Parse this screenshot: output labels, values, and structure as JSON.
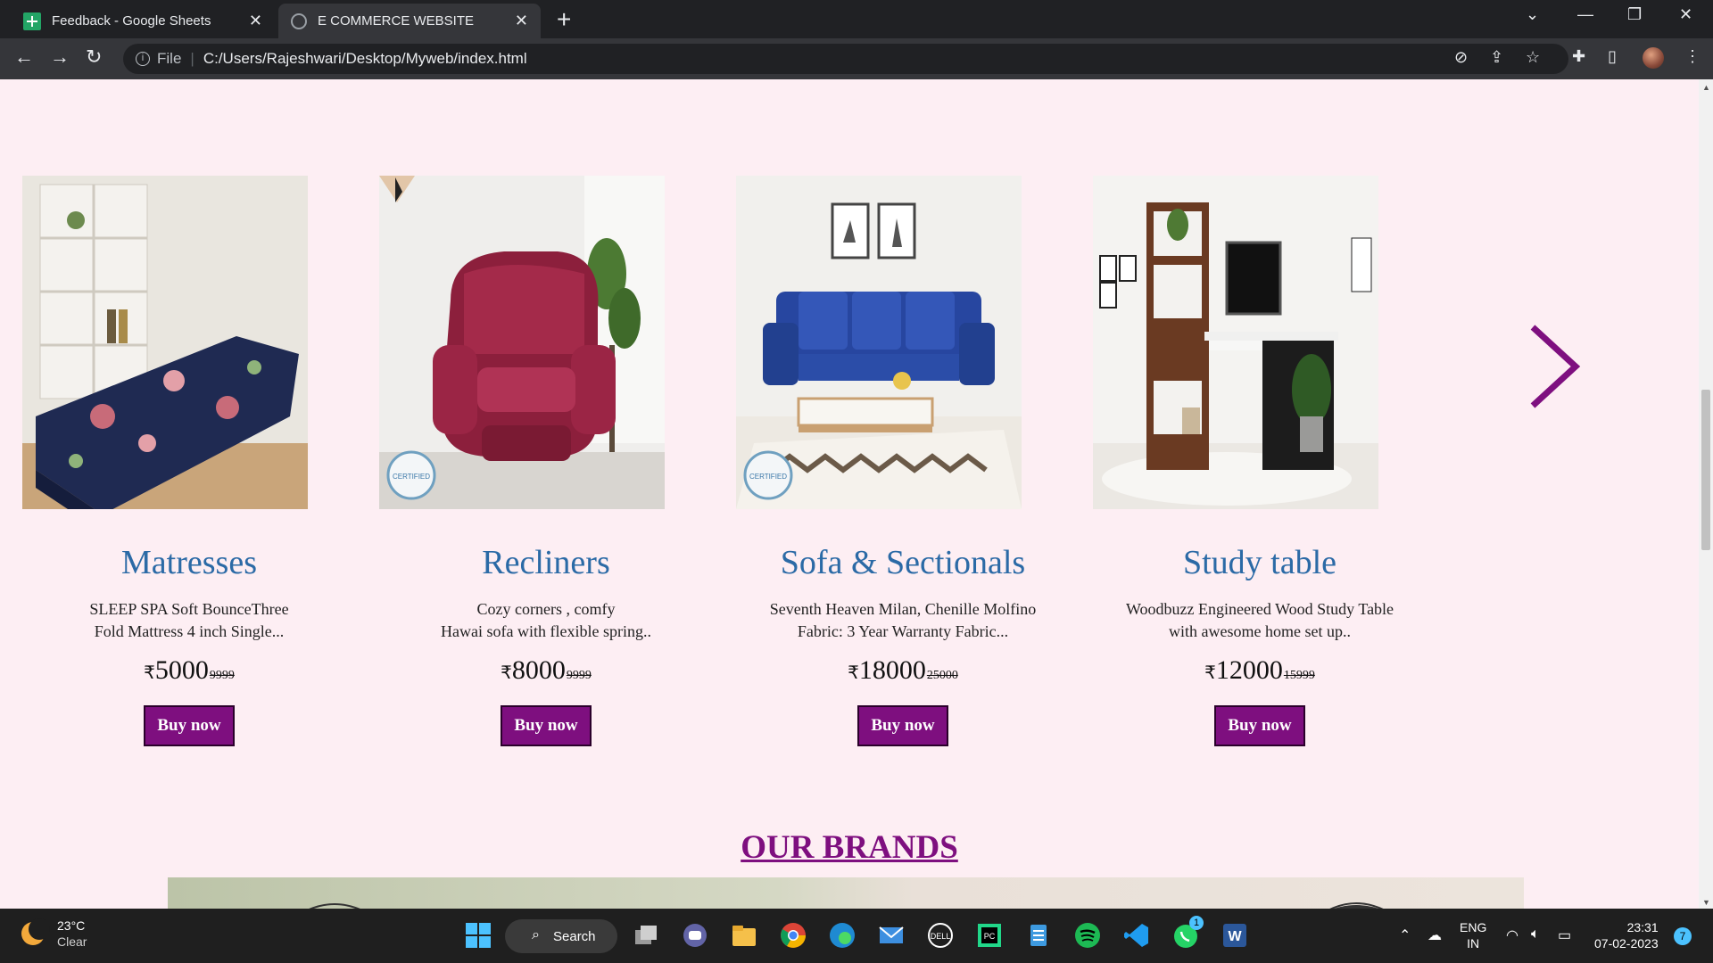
{
  "browser": {
    "tabs": [
      {
        "title": "Feedback - Google Sheets",
        "icon": "sheets-icon"
      },
      {
        "title": "E COMMERCE WEBSITE",
        "icon": "globe-icon",
        "active": true
      }
    ],
    "address": {
      "scheme_label": "File",
      "url": "C:/Users/Rajeshwari/Desktop/Myweb/index.html"
    }
  },
  "products": [
    {
      "name": "Matresses",
      "desc_line1": "SLEEP SPA Soft BounceThree",
      "desc_line2": "Fold Mattress 4 inch Single...",
      "currency": "₹",
      "price": "5000",
      "old_price": "9999",
      "buy_label": "Buy now"
    },
    {
      "name": "Recliners",
      "desc_line1": "Cozy corners , comfy",
      "desc_line2": "Hawai sofa with flexible spring..",
      "currency": "₹",
      "price": "8000",
      "old_price": "9999",
      "buy_label": "Buy now"
    },
    {
      "name": "Sofa & Sectionals",
      "desc_line1": "Seventh Heaven Milan, Chenille Molfino",
      "desc_line2": "Fabric: 3 Year Warranty Fabric...",
      "currency": "₹",
      "price": "18000",
      "old_price": "25000",
      "buy_label": "Buy now"
    },
    {
      "name": "Study table",
      "desc_line1": "Woodbuzz Engineered Wood Study Table",
      "desc_line2": "with awesome home set up..",
      "currency": "₹",
      "price": "12000",
      "old_price": "15999",
      "buy_label": "Buy now"
    }
  ],
  "badge_text": "CERTIFIED",
  "section_title": "OUR BRANDS",
  "colors": {
    "accent": "#7e0f7f",
    "heading": "#2b6aa6",
    "page_bg": "#fdeef3"
  },
  "taskbar": {
    "weather_temp": "23°C",
    "weather_desc": "Clear",
    "search_label": "Search",
    "whatsapp_badge": "1",
    "lang_line1": "ENG",
    "lang_line2": "IN",
    "time": "23:31",
    "date": "07-02-2023",
    "notifications": "7"
  }
}
